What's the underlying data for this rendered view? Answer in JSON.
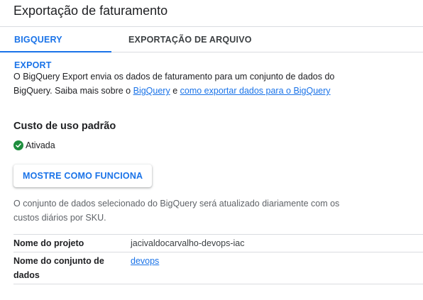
{
  "header": {
    "title": "Exportação de faturamento"
  },
  "tabs": [
    {
      "label": "BIGQUERY EXPORT",
      "active": true
    },
    {
      "label": "EXPORTAÇÃO DE ARQUIVO",
      "active": false
    }
  ],
  "description": {
    "text_before": "O BigQuery Export envia os dados de faturamento para um conjunto de dados do BigQuery. Saiba mais sobre o ",
    "link1": "BigQuery",
    "connector": " e ",
    "link2": "como exportar dados para o BigQuery"
  },
  "section": {
    "title": "Custo de uso padrão",
    "status": "Ativada",
    "status_icon": "check-circle-icon",
    "status_color": "#1e8e3e",
    "button_label": "MOSTRE COMO FUNCIONA",
    "note": "O conjunto de dados selecionado do BigQuery será atualizado diariamente com os custos diários por SKU."
  },
  "details": {
    "project_label": "Nome do projeto",
    "project_value": "jacivaldocarvalho-devops-iac",
    "dataset_label": "Nome do conjunto de dados",
    "dataset_value": "devops"
  },
  "colors": {
    "accent": "#1a73e8",
    "text": "#202124",
    "muted": "#5f6368"
  }
}
